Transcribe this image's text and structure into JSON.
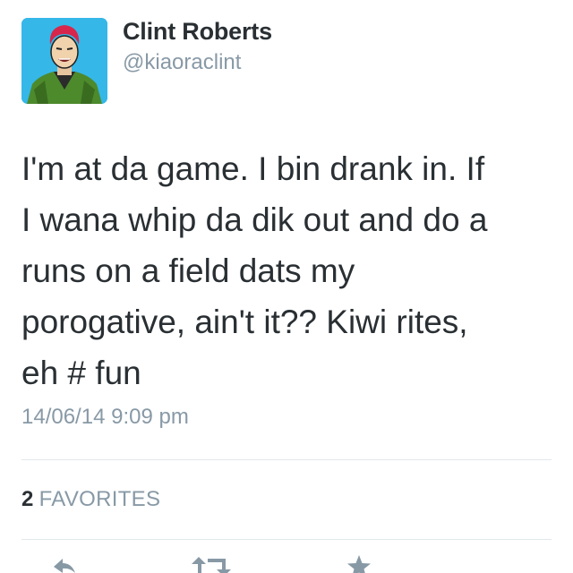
{
  "tweet": {
    "author": {
      "display_name": "Clint Roberts",
      "handle": "@kiaoraclint",
      "avatar_icon": "profile-photo"
    },
    "text": "I'm at da game. I bin drank in.  If\nI wana whip da dik out and do a\nruns on a field dats my\nporogative,  ain't it?? Kiwi rites,\neh # fun",
    "timestamp": "14/06/14 9:09 pm",
    "stats": {
      "favorites_count": "2",
      "favorites_label": "FAVORITES"
    },
    "actions": [
      {
        "name": "reply",
        "icon": "reply-icon"
      },
      {
        "name": "retweet",
        "icon": "retweet-icon"
      },
      {
        "name": "favorite",
        "icon": "star-icon"
      }
    ]
  },
  "colors": {
    "text_primary": "#292f33",
    "text_secondary": "#8899a6",
    "divider": "#e1e8ed",
    "avatar_background": "#35b7e8"
  }
}
